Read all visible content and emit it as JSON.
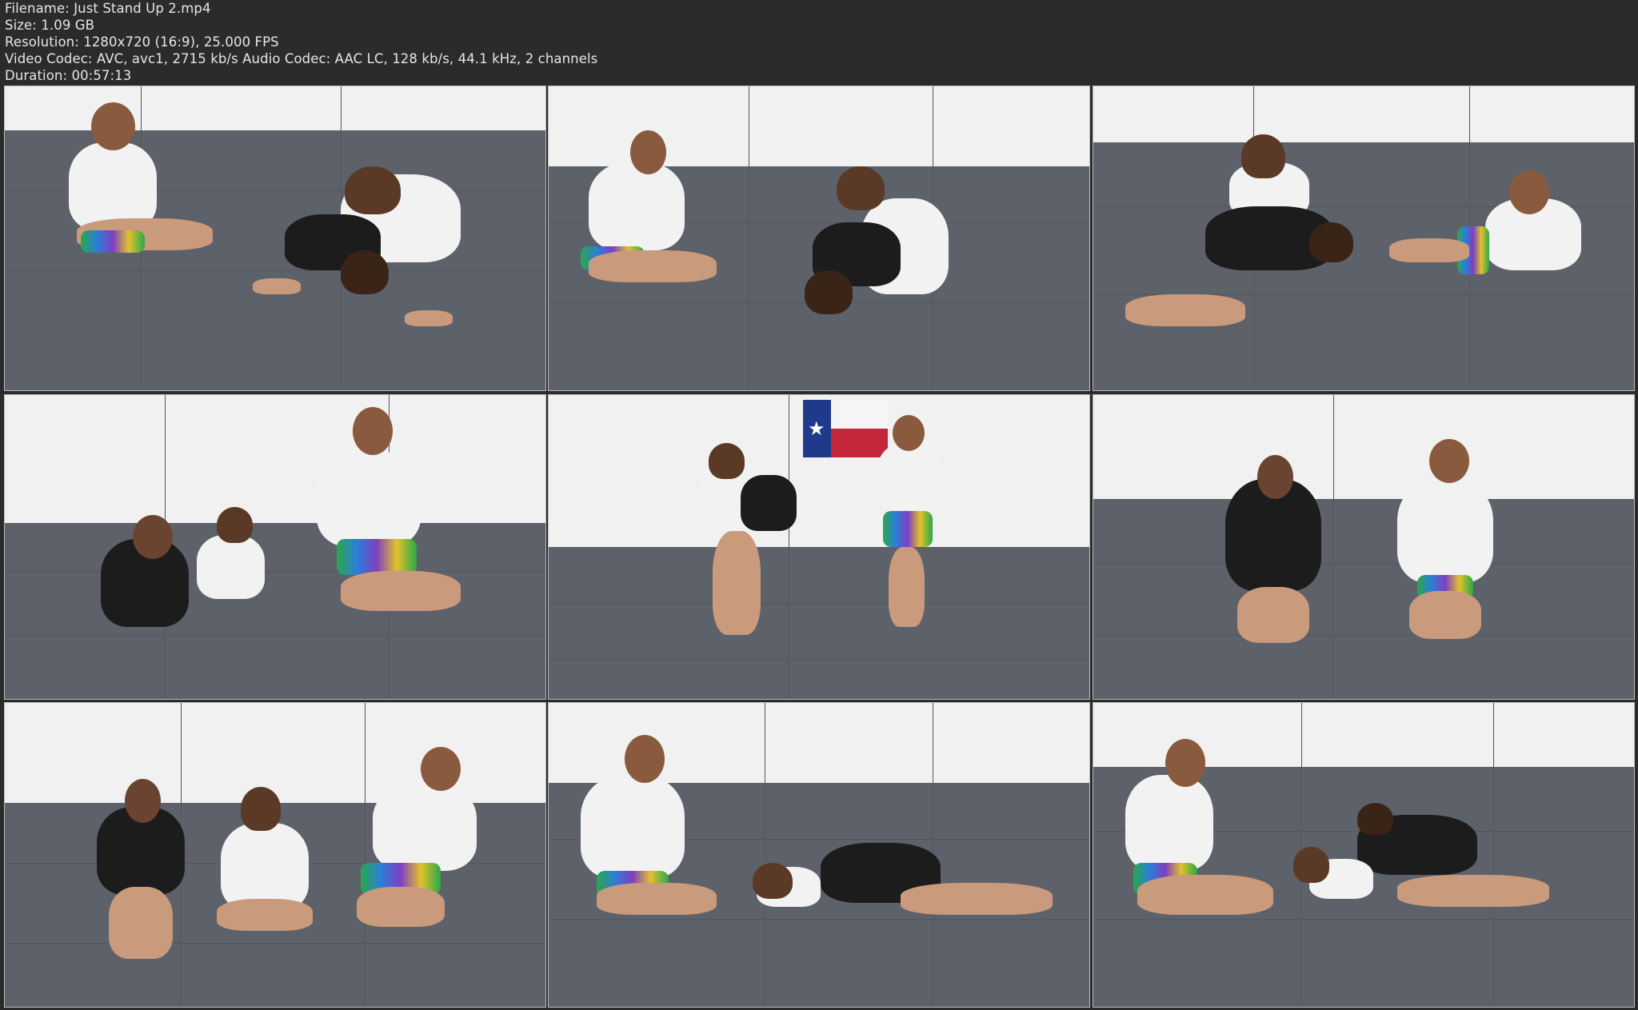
{
  "info": {
    "filename": "Filename: Just Stand Up 2.mp4",
    "size": "Size: 1.09 GB",
    "resolution": "Resolution: 1280x720 (16:9), 25.000 FPS",
    "codec": "Video Codec: AVC, avc1, 2715 kb/s Audio Codec: AAC LC, 128 kb/s, 44.1 kHz, 2 channels",
    "duration": "Duration: 00:57:13"
  },
  "thumbnails": [
    {
      "scene": "seated-instructor-and-turtle-pair"
    },
    {
      "scene": "seated-instructor-and-turtle-pair-wide"
    },
    {
      "scene": "pin-on-mat-and-reclining-instructor"
    },
    {
      "scene": "three-athletes-kneeling-sitting"
    },
    {
      "scene": "standing-lift-with-texas-flag"
    },
    {
      "scene": "two-athletes-kneeling"
    },
    {
      "scene": "three-athletes-seated-row"
    },
    {
      "scene": "seated-instructor-and-ground-scramble"
    },
    {
      "scene": "seated-instructor-and-ground-pin"
    }
  ],
  "colors": {
    "background": "#2b2b2b",
    "text": "#e6e6e6",
    "mat": "#5d616a",
    "wall": "#f1f1f1"
  }
}
